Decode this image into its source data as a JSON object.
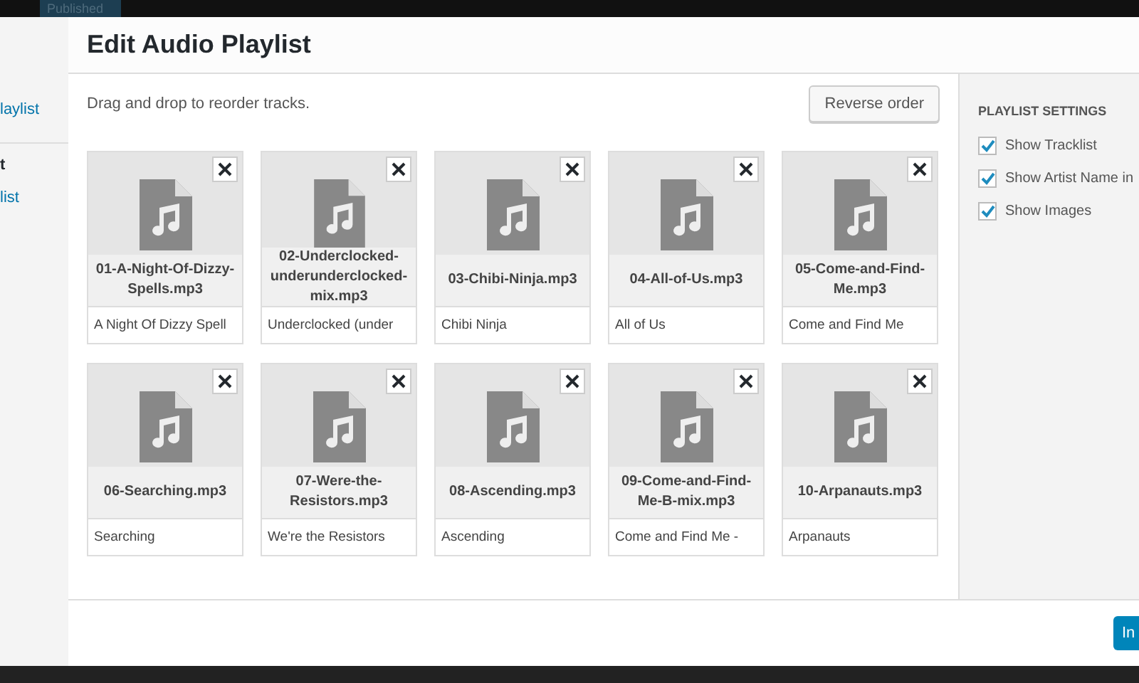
{
  "top_bar": {
    "button": "Published"
  },
  "sidebar": {
    "items": [
      {
        "label": "laylist",
        "kind": "link"
      },
      {
        "label": "t",
        "kind": "heading"
      },
      {
        "label": "list",
        "kind": "link"
      }
    ]
  },
  "modal": {
    "title": "Edit Audio Playlist",
    "hint": "Drag and drop to reorder tracks.",
    "reverse_button": "Reverse order",
    "tracks": [
      {
        "filename": "01-A-Night-Of-Dizzy-Spells.mp3",
        "caption": "A Night Of Dizzy Spell"
      },
      {
        "filename": "02-Underclocked-underunderclocked-mix.mp3",
        "caption": "Underclocked (under"
      },
      {
        "filename": "03-Chibi-Ninja.mp3",
        "caption": "Chibi Ninja"
      },
      {
        "filename": "04-All-of-Us.mp3",
        "caption": "All of Us"
      },
      {
        "filename": "05-Come-and-Find-Me.mp3",
        "caption": "Come and Find Me"
      },
      {
        "filename": "06-Searching.mp3",
        "caption": "Searching"
      },
      {
        "filename": "07-Were-the-Resistors.mp3",
        "caption": "We're the Resistors"
      },
      {
        "filename": "08-Ascending.mp3",
        "caption": "Ascending"
      },
      {
        "filename": "09-Come-and-Find-Me-B-mix.mp3",
        "caption": "Come and Find Me -"
      },
      {
        "filename": "10-Arpanauts.mp3",
        "caption": "Arpanauts"
      }
    ],
    "settings": {
      "title": "PLAYLIST SETTINGS",
      "options": [
        {
          "label": "Show Tracklist",
          "checked": true
        },
        {
          "label": "Show Artist Name in",
          "checked": true
        },
        {
          "label": "Show Images",
          "checked": true
        }
      ]
    },
    "insert_button": "In"
  }
}
